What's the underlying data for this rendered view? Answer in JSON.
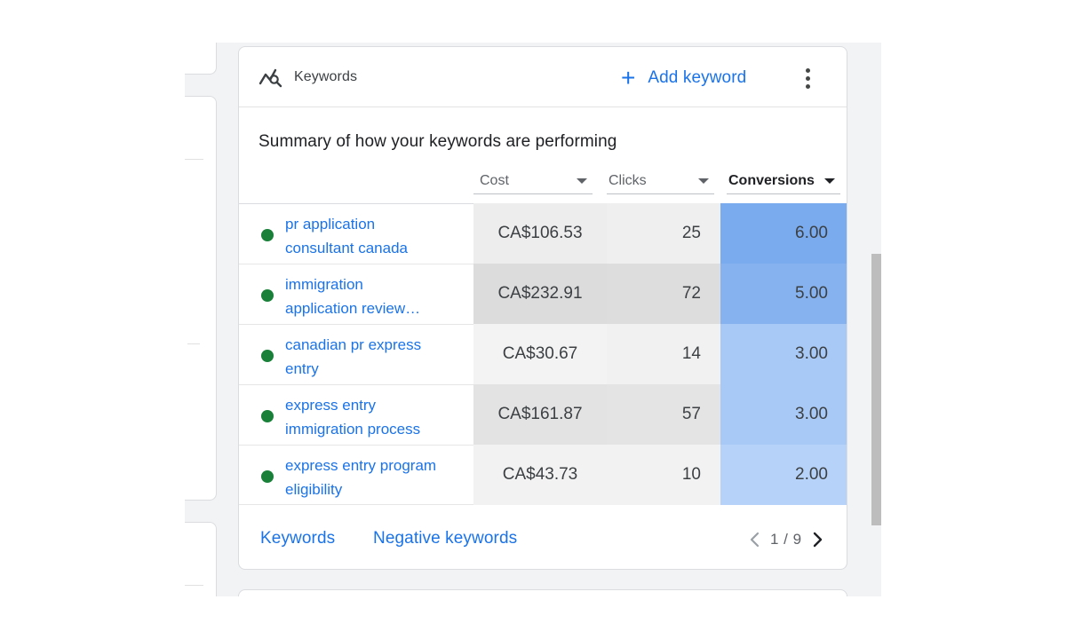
{
  "card": {
    "title": "Keywords",
    "icon": "keyword-search-icon",
    "add_keyword_label": "Add keyword",
    "subtitle": "Summary of how your keywords are performing"
  },
  "columns": [
    {
      "label": "Cost",
      "sorted": false
    },
    {
      "label": "Clicks",
      "sorted": false
    },
    {
      "label": "Conversions",
      "sorted": true
    }
  ],
  "rows": [
    {
      "keyword_line1": "pr application",
      "keyword_line2": "consultant canada",
      "status": "enabled",
      "cost": "CA$106.53",
      "clicks": "25",
      "conversions": "6.00",
      "cost_bg": "#ededed",
      "clicks_bg": "#efefef",
      "conv_bg": "#7aabee"
    },
    {
      "keyword_line1": "immigration",
      "keyword_line2": "application review…",
      "status": "enabled",
      "cost": "CA$232.91",
      "clicks": "72",
      "conversions": "5.00",
      "cost_bg": "#dcdcdc",
      "clicks_bg": "#dddddd",
      "conv_bg": "#86b3f0"
    },
    {
      "keyword_line1": "canadian pr express",
      "keyword_line2": "entry",
      "status": "enabled",
      "cost": "CA$30.67",
      "clicks": "14",
      "conversions": "3.00",
      "cost_bg": "#f3f3f3",
      "clicks_bg": "#f1f1f1",
      "conv_bg": "#a8c8f5"
    },
    {
      "keyword_line1": "express entry",
      "keyword_line2": "immigration process",
      "status": "enabled",
      "cost": "CA$161.87",
      "clicks": "57",
      "conversions": "3.00",
      "cost_bg": "#e3e3e3",
      "clicks_bg": "#e4e4e4",
      "conv_bg": "#a8c8f5"
    },
    {
      "keyword_line1": "express entry program",
      "keyword_line2": "eligibility",
      "status": "enabled",
      "cost": "CA$43.73",
      "clicks": "10",
      "conversions": "2.00",
      "cost_bg": "#f2f2f2",
      "clicks_bg": "#f2f2f2",
      "conv_bg": "#b6d2f8"
    }
  ],
  "footer": {
    "keywords_link": "Keywords",
    "negative_keywords_link": "Negative keywords",
    "page_indicator": "1 / 9"
  },
  "colors": {
    "accent": "#1a73e8",
    "status_enabled": "#188038"
  }
}
